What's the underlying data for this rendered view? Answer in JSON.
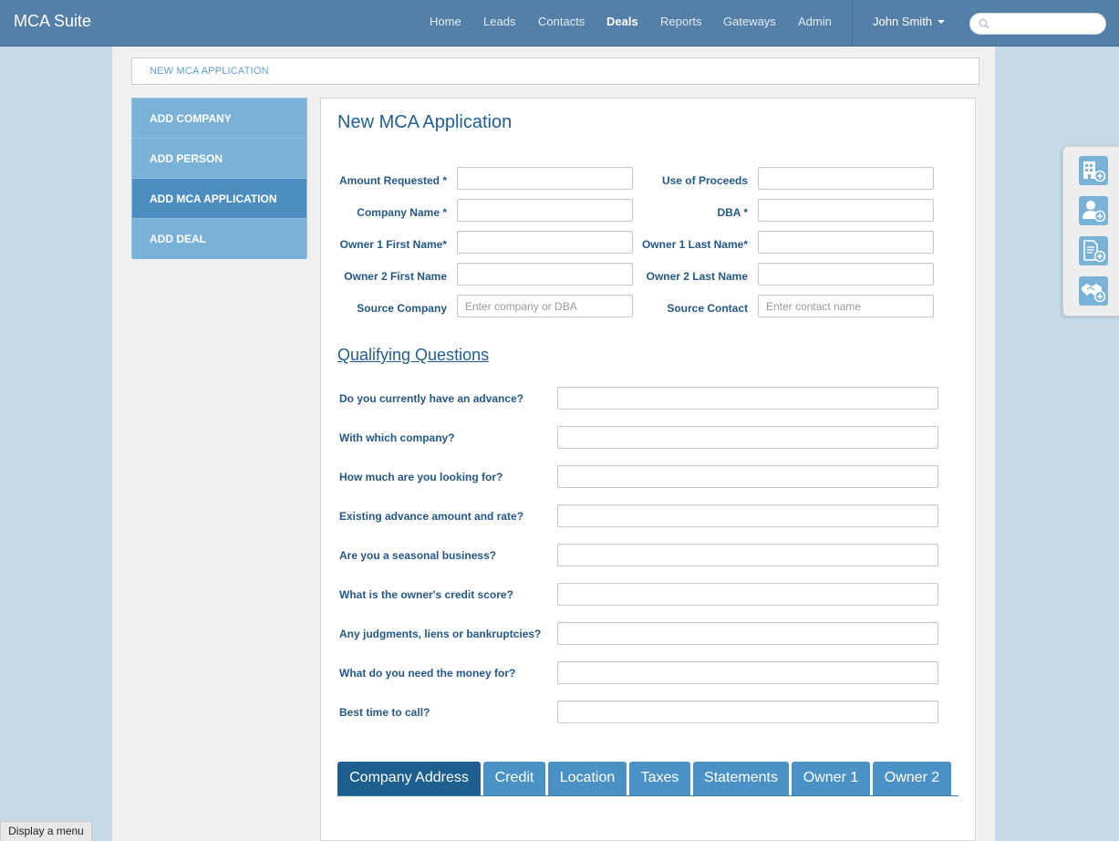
{
  "app": {
    "brand": "MCA Suite"
  },
  "nav": {
    "links": [
      "Home",
      "Leads",
      "Contacts",
      "Deals",
      "Reports",
      "Gateways",
      "Admin"
    ],
    "active": "Deals",
    "user": "John Smith"
  },
  "breadcrumb": "NEW MCA APPLICATION",
  "side_menu": [
    "ADD COMPANY",
    "ADD PERSON",
    "ADD MCA APPLICATION",
    "ADD DEAL"
  ],
  "side_menu_active": "ADD MCA APPLICATION",
  "form": {
    "title": "New MCA Application",
    "fields": {
      "amount_requested": "Amount Requested *",
      "use_of_proceeds": "Use of Proceeds",
      "company_name": "Company Name *",
      "dba": "DBA *",
      "owner1_first": "Owner 1 First Name*",
      "owner1_last": "Owner 1 Last Name*",
      "owner2_first": "Owner 2 First Name",
      "owner2_last": "Owner 2 Last Name",
      "source_company": "Source Company",
      "source_company_placeholder": "Enter company or DBA",
      "source_contact": "Source Contact",
      "source_contact_placeholder": "Enter contact name"
    },
    "qualifying_heading": "Qualifying Questions",
    "questions": [
      "Do you currently have an advance?",
      "With which company?",
      "How much are you looking for?",
      "Existing advance amount and rate?",
      "Are you a seasonal business?",
      "What is the owner's credit score?",
      "Any judgments, liens or bankruptcies?",
      "What do you need the money for?",
      "Best time to call?"
    ],
    "tabs": [
      "Company Address",
      "Credit",
      "Location",
      "Taxes",
      "Statements",
      "Owner 1",
      "Owner 2"
    ],
    "active_tab": "Company Address"
  },
  "toolbar_icons": [
    "add-company-icon",
    "add-person-icon",
    "add-application-icon",
    "add-deal-icon"
  ],
  "footer": {
    "display_menu": "Display a menu"
  },
  "colors": {
    "navbar": "#547fa6",
    "accent": "#1f5f94",
    "menu": "#7ab1d6",
    "menu_active": "#4c8ec0",
    "tab": "#4a92c6",
    "tab_active": "#1d5f8e"
  }
}
